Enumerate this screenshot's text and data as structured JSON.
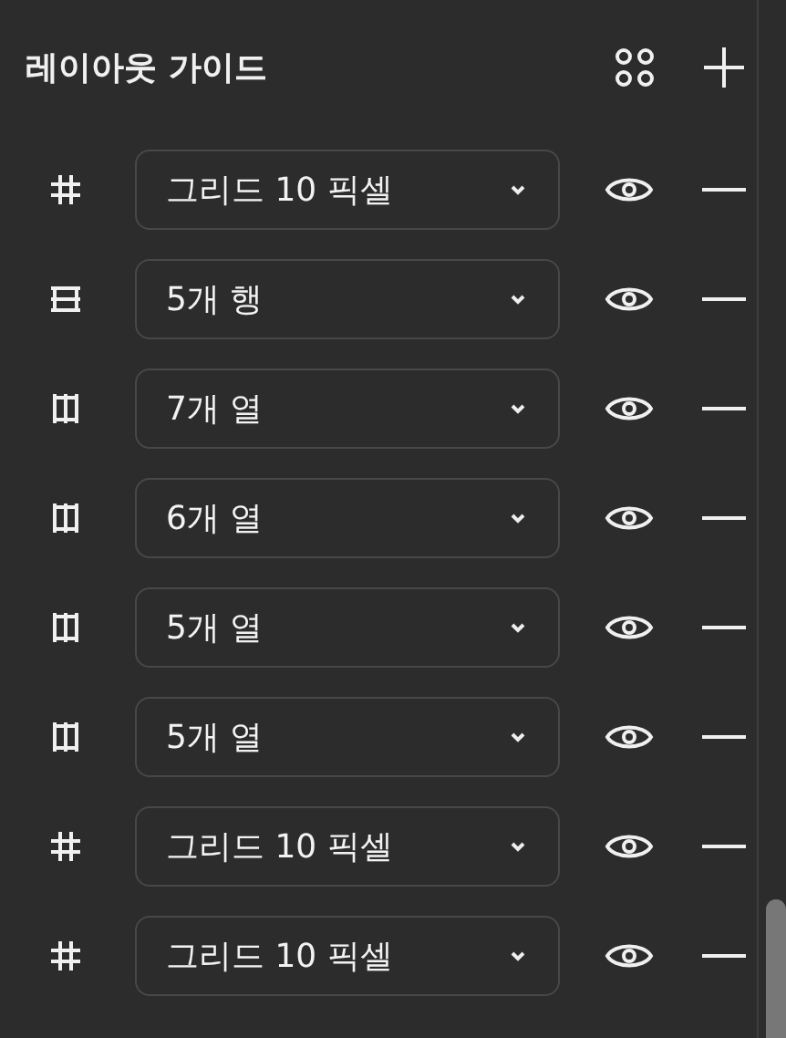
{
  "panel": {
    "title": "레이아웃 가이드"
  },
  "guides": [
    {
      "kind": "grid",
      "label": "그리드 10 픽셀"
    },
    {
      "kind": "rows",
      "label": "5개 행"
    },
    {
      "kind": "columns",
      "label": "7개 열"
    },
    {
      "kind": "columns",
      "label": "6개 열"
    },
    {
      "kind": "columns",
      "label": "5개 열"
    },
    {
      "kind": "columns",
      "label": "5개 열"
    },
    {
      "kind": "grid",
      "label": "그리드 10 픽셀"
    },
    {
      "kind": "grid",
      "label": "그리드 10 픽셀"
    }
  ]
}
